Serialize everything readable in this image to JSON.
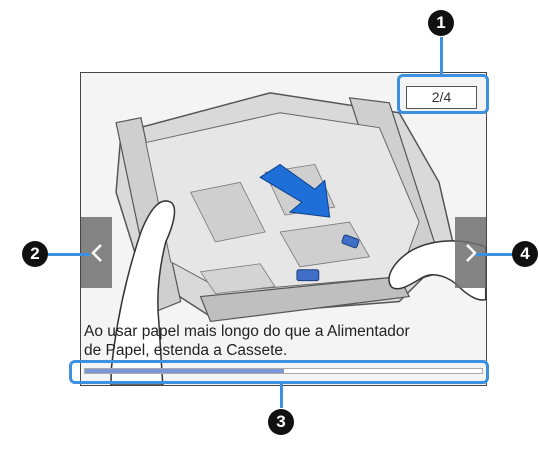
{
  "screen": {
    "page_indicator": "2/4",
    "caption": "Ao usar papel mais longo do que a Alimentador\nde Papel, estenda a Cassete.",
    "progress_fraction": 0.5,
    "prev_icon": "chevron-left-icon",
    "next_icon": "chevron-right-icon"
  },
  "callouts": {
    "page_indicator": "1",
    "prev_button": "2",
    "progress_bar": "3",
    "next_button": "4"
  },
  "colors": {
    "highlight": "#3d8fe0",
    "progress": "#7c95d6",
    "arrow": "#1f6fd8",
    "nav_button": "#6e6e6e"
  }
}
